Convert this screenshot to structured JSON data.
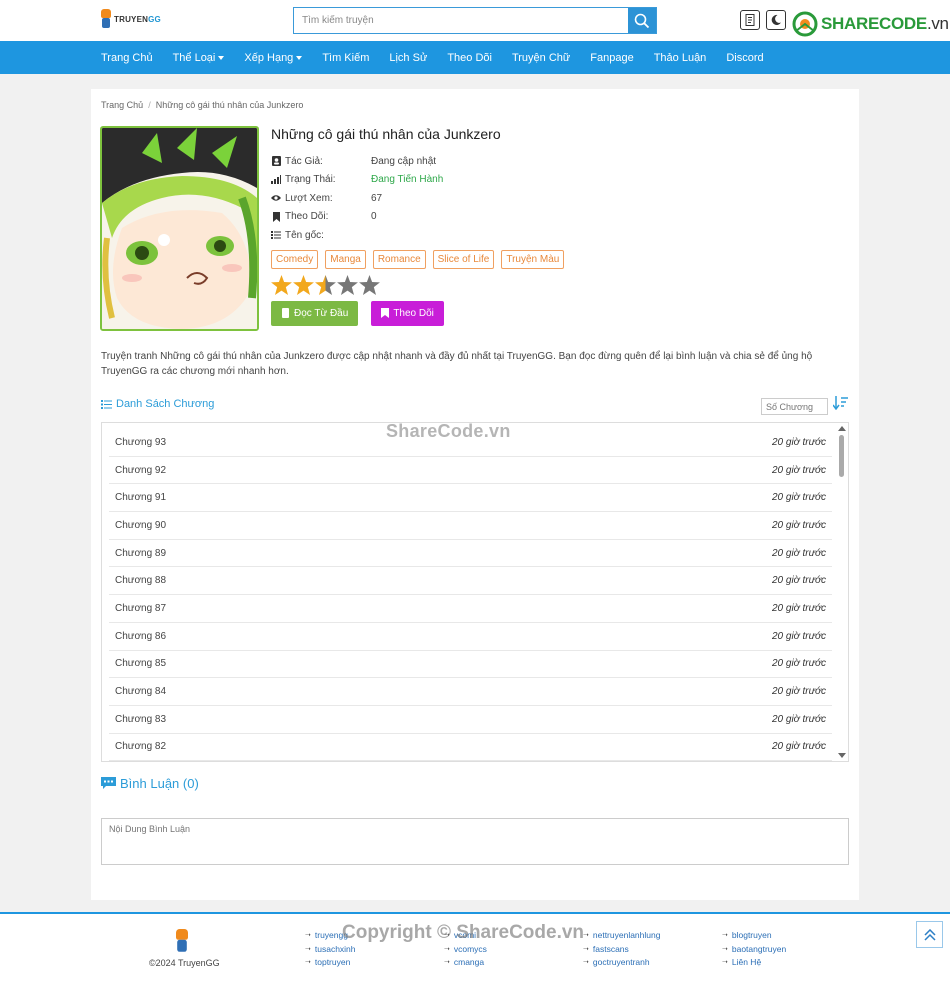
{
  "brand": {
    "logo_text_prefix": "TRUYEN",
    "logo_text_suffix": "GG"
  },
  "search": {
    "placeholder": "Tìm kiếm truyện"
  },
  "watermark_brand": {
    "main": "SHARECODE",
    "suffix": ".vn"
  },
  "nav": [
    {
      "label": "Trang Chủ",
      "dropdown": false
    },
    {
      "label": "Thể Loại",
      "dropdown": true
    },
    {
      "label": "Xếp Hạng",
      "dropdown": true
    },
    {
      "label": "Tìm Kiếm",
      "dropdown": false
    },
    {
      "label": "Lịch Sử",
      "dropdown": false
    },
    {
      "label": "Theo Dõi",
      "dropdown": false
    },
    {
      "label": "Truyện Chữ",
      "dropdown": false
    },
    {
      "label": "Fanpage",
      "dropdown": false
    },
    {
      "label": "Thảo Luận",
      "dropdown": false
    },
    {
      "label": "Discord",
      "dropdown": false
    }
  ],
  "breadcrumb": {
    "home": "Trang Chủ",
    "sep": "/",
    "current": "Những cô gái thú nhân của Junkzero"
  },
  "comic": {
    "title": "Những cô gái thú nhân của Junkzero",
    "info": [
      {
        "icon": "user-card-icon",
        "label": "Tác Giả:",
        "value": "Đang cập nhật",
        "green": false
      },
      {
        "icon": "signal-icon",
        "label": "Trạng Thái:",
        "value": "Đang Tiến Hành",
        "green": true
      },
      {
        "icon": "eye-icon",
        "label": "Lượt Xem:",
        "value": "67",
        "green": false
      },
      {
        "icon": "bookmark-icon",
        "label": "Theo Dõi:",
        "value": "0",
        "green": false
      },
      {
        "icon": "list-icon",
        "label": "Tên gốc:",
        "value": "",
        "green": false
      }
    ],
    "tags": [
      "Comedy",
      "Manga",
      "Romance",
      "Slice of Life",
      "Truyện Màu"
    ],
    "rating": 2.5,
    "rating_max": 5,
    "star_color": "#f2a81d",
    "read_button": "Đọc Từ Đầu",
    "follow_button": "Theo Dõi"
  },
  "description": "Truyện tranh Những cô gái thú nhân của Junkzero được cập nhật nhanh và đầy đủ nhất tại TruyenGG. Bạn đọc đừng quên để lại bình luận và chia sẻ để ủng hộ TruyenGG ra các chương mới nhanh hơn.",
  "chapters": {
    "heading": "Danh Sách Chương",
    "search_placeholder": "Số Chương",
    "items": [
      {
        "name": "Chương 93",
        "time": "20 giờ trước"
      },
      {
        "name": "Chương 92",
        "time": "20 giờ trước"
      },
      {
        "name": "Chương 91",
        "time": "20 giờ trước"
      },
      {
        "name": "Chương 90",
        "time": "20 giờ trước"
      },
      {
        "name": "Chương 89",
        "time": "20 giờ trước"
      },
      {
        "name": "Chương 88",
        "time": "20 giờ trước"
      },
      {
        "name": "Chương 87",
        "time": "20 giờ trước"
      },
      {
        "name": "Chương 86",
        "time": "20 giờ trước"
      },
      {
        "name": "Chương 85",
        "time": "20 giờ trước"
      },
      {
        "name": "Chương 84",
        "time": "20 giờ trước"
      },
      {
        "name": "Chương 83",
        "time": "20 giờ trước"
      },
      {
        "name": "Chương 82",
        "time": "20 giờ trước"
      }
    ]
  },
  "watermark_mid": "ShareCode.vn",
  "comments": {
    "heading": "Bình Luận (0)",
    "placeholder": "Nội Dung Bình Luận"
  },
  "footer": {
    "copyright": "©2024 TruyenGG",
    "watermark": "Copyright © ShareCode.vn",
    "columns": [
      [
        "truyengg",
        "tusachxinh",
        "toptruyen"
      ],
      [
        "vcomi",
        "vcomycs",
        "cmanga"
      ],
      [
        "nettruyenlanhlung",
        "fastscans",
        "goctruyentranh"
      ],
      [
        "blogtruyen",
        "baotangtruyen",
        "Liên Hệ"
      ]
    ]
  }
}
